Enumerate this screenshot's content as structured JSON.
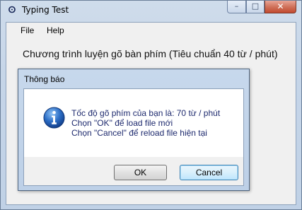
{
  "window": {
    "title": "Typing Test",
    "icon": "typing-test-app-icon",
    "icon_glyph": "ⵙ",
    "controls": {
      "minimize": "–",
      "maximize": "□",
      "close": "✕"
    }
  },
  "menu": {
    "items": [
      "File",
      "Help"
    ]
  },
  "main": {
    "headline": "Chương trình luyện gõ bàn phím (Tiêu chuẩn 40 từ / phút)"
  },
  "dialog": {
    "title": "Thông báo",
    "icon": "info-icon",
    "lines": [
      "Tốc độ gõ phím của bạn là: 70 từ / phút",
      "Chọn \"OK\" để load file mới",
      "Chọn \"Cancel\" để reload file hiện tại"
    ],
    "buttons": {
      "ok": "OK",
      "cancel": "Cancel"
    }
  }
}
